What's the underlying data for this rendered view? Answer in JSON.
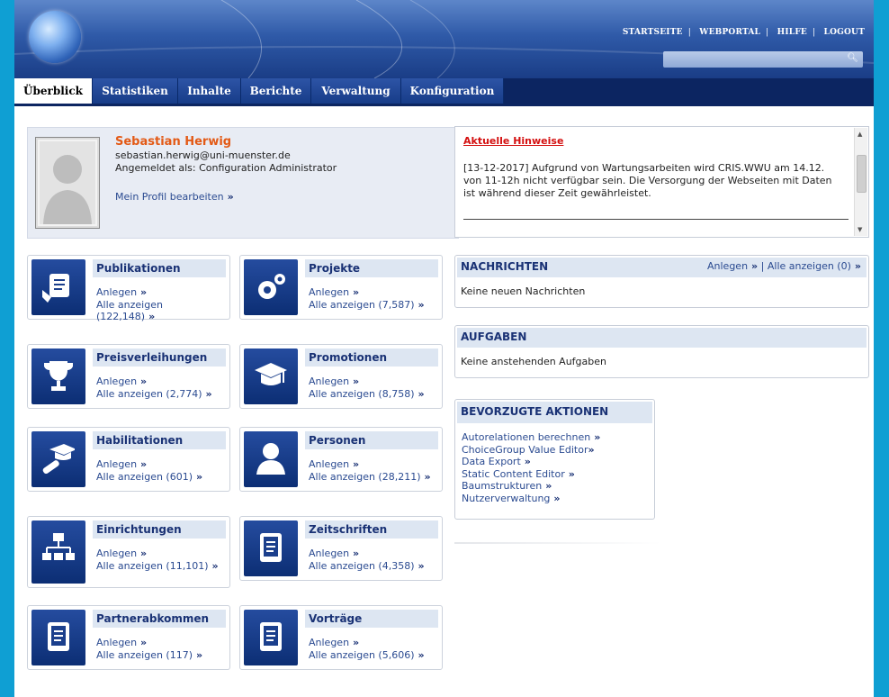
{
  "header": {
    "nav": [
      "STARTSEITE",
      "WEBPORTAL",
      "HILFE",
      "LOGOUT"
    ],
    "search_placeholder": ""
  },
  "tabs": [
    "Überblick",
    "Statistiken",
    "Inhalte",
    "Berichte",
    "Verwaltung",
    "Konfiguration"
  ],
  "profile": {
    "name": "Sebastian Herwig",
    "email": "sebastian.herwig@uni-muenster.de",
    "role": "Angemeldet als: Configuration Administrator",
    "edit": "Mein Profil bearbeiten"
  },
  "notice": {
    "title": "Aktuelle Hinweise",
    "text": "[13-12-2017] Aufgrund von Wartungsarbeiten wird CRIS.WWU am 14.12. von 11-12h nicht verfügbar sein. Die Versorgung der Webseiten mit Daten ist während dieser Zeit gewährleistet."
  },
  "cards": [
    {
      "title": "Publikationen",
      "create": "Anlegen",
      "all": "Alle anzeigen (122,148)",
      "icon": "scroll-hand-icon"
    },
    {
      "title": "Projekte",
      "create": "Anlegen",
      "all": "Alle anzeigen (7,587)",
      "icon": "gears-icon"
    },
    {
      "title": "Preisverleihungen",
      "create": "Anlegen",
      "all": "Alle anzeigen (2,774)",
      "icon": "trophy-icon"
    },
    {
      "title": "Promotionen",
      "create": "Anlegen",
      "all": "Alle anzeigen (8,758)",
      "icon": "graduation-cap-icon"
    },
    {
      "title": "Habilitationen",
      "create": "Anlegen",
      "all": "Alle anzeigen (601)",
      "icon": "cap-diploma-icon"
    },
    {
      "title": "Personen",
      "create": "Anlegen",
      "all": "Alle anzeigen (28,211)",
      "icon": "person-icon"
    },
    {
      "title": "Einrichtungen",
      "create": "Anlegen",
      "all": "Alle anzeigen (11,101)",
      "icon": "org-chart-icon"
    },
    {
      "title": "Zeitschriften",
      "create": "Anlegen",
      "all": "Alle anzeigen (4,358)",
      "icon": "clipboard-icon"
    },
    {
      "title": "Partnerabkommen",
      "create": "Anlegen",
      "all": "Alle anzeigen (117)",
      "icon": "clipboard-icon"
    },
    {
      "title": "Vorträge",
      "create": "Anlegen",
      "all": "Alle anzeigen (5,606)",
      "icon": "clipboard-icon"
    }
  ],
  "messages": {
    "title": "NACHRICHTEN",
    "create": "Anlegen",
    "all": "Alle anzeigen (0)",
    "sep": "|",
    "empty": "Keine neuen Nachrichten"
  },
  "tasks": {
    "title": "AUFGABEN",
    "empty": "Keine anstehenden Aufgaben"
  },
  "favorites": {
    "title": "BEVORZUGTE AKTIONEN",
    "items": [
      "Autorelationen berechnen",
      "ChoiceGroup Value Editor",
      "Data Export",
      "Static Content Editor",
      "Baumstrukturen",
      "Nutzerverwaltung"
    ]
  },
  "colors": {
    "accent_name": "#e35a16",
    "notice_title": "#d41010",
    "nav_dark": "#0c2561",
    "page_bg": "#0f9fd3"
  }
}
